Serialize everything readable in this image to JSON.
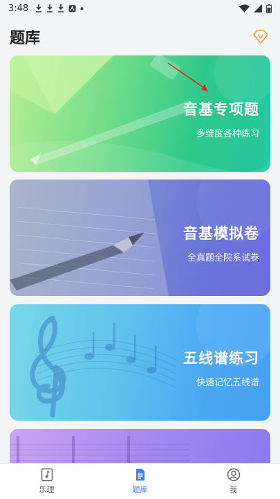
{
  "status_bar": {
    "time": "3:48"
  },
  "header": {
    "title": "题库"
  },
  "cards": [
    {
      "title": "音基专项题",
      "subtitle": "多维度各种练习"
    },
    {
      "title": "音基模拟卷",
      "subtitle": "全真题全院系试卷"
    },
    {
      "title": "五线谱练习",
      "subtitle": "快速记忆五线谱"
    }
  ],
  "tabbar": {
    "tabs": [
      {
        "label": "乐理",
        "icon": "music-book-icon"
      },
      {
        "label": "题库",
        "icon": "document-icon",
        "active": true
      },
      {
        "label": "我",
        "icon": "profile-icon"
      }
    ]
  },
  "colors": {
    "accent": "#3b82f6",
    "card1": "#2fc98a",
    "card2": "#6a74d8",
    "card3": "#4aa8f3",
    "card4": "#a68af0"
  }
}
